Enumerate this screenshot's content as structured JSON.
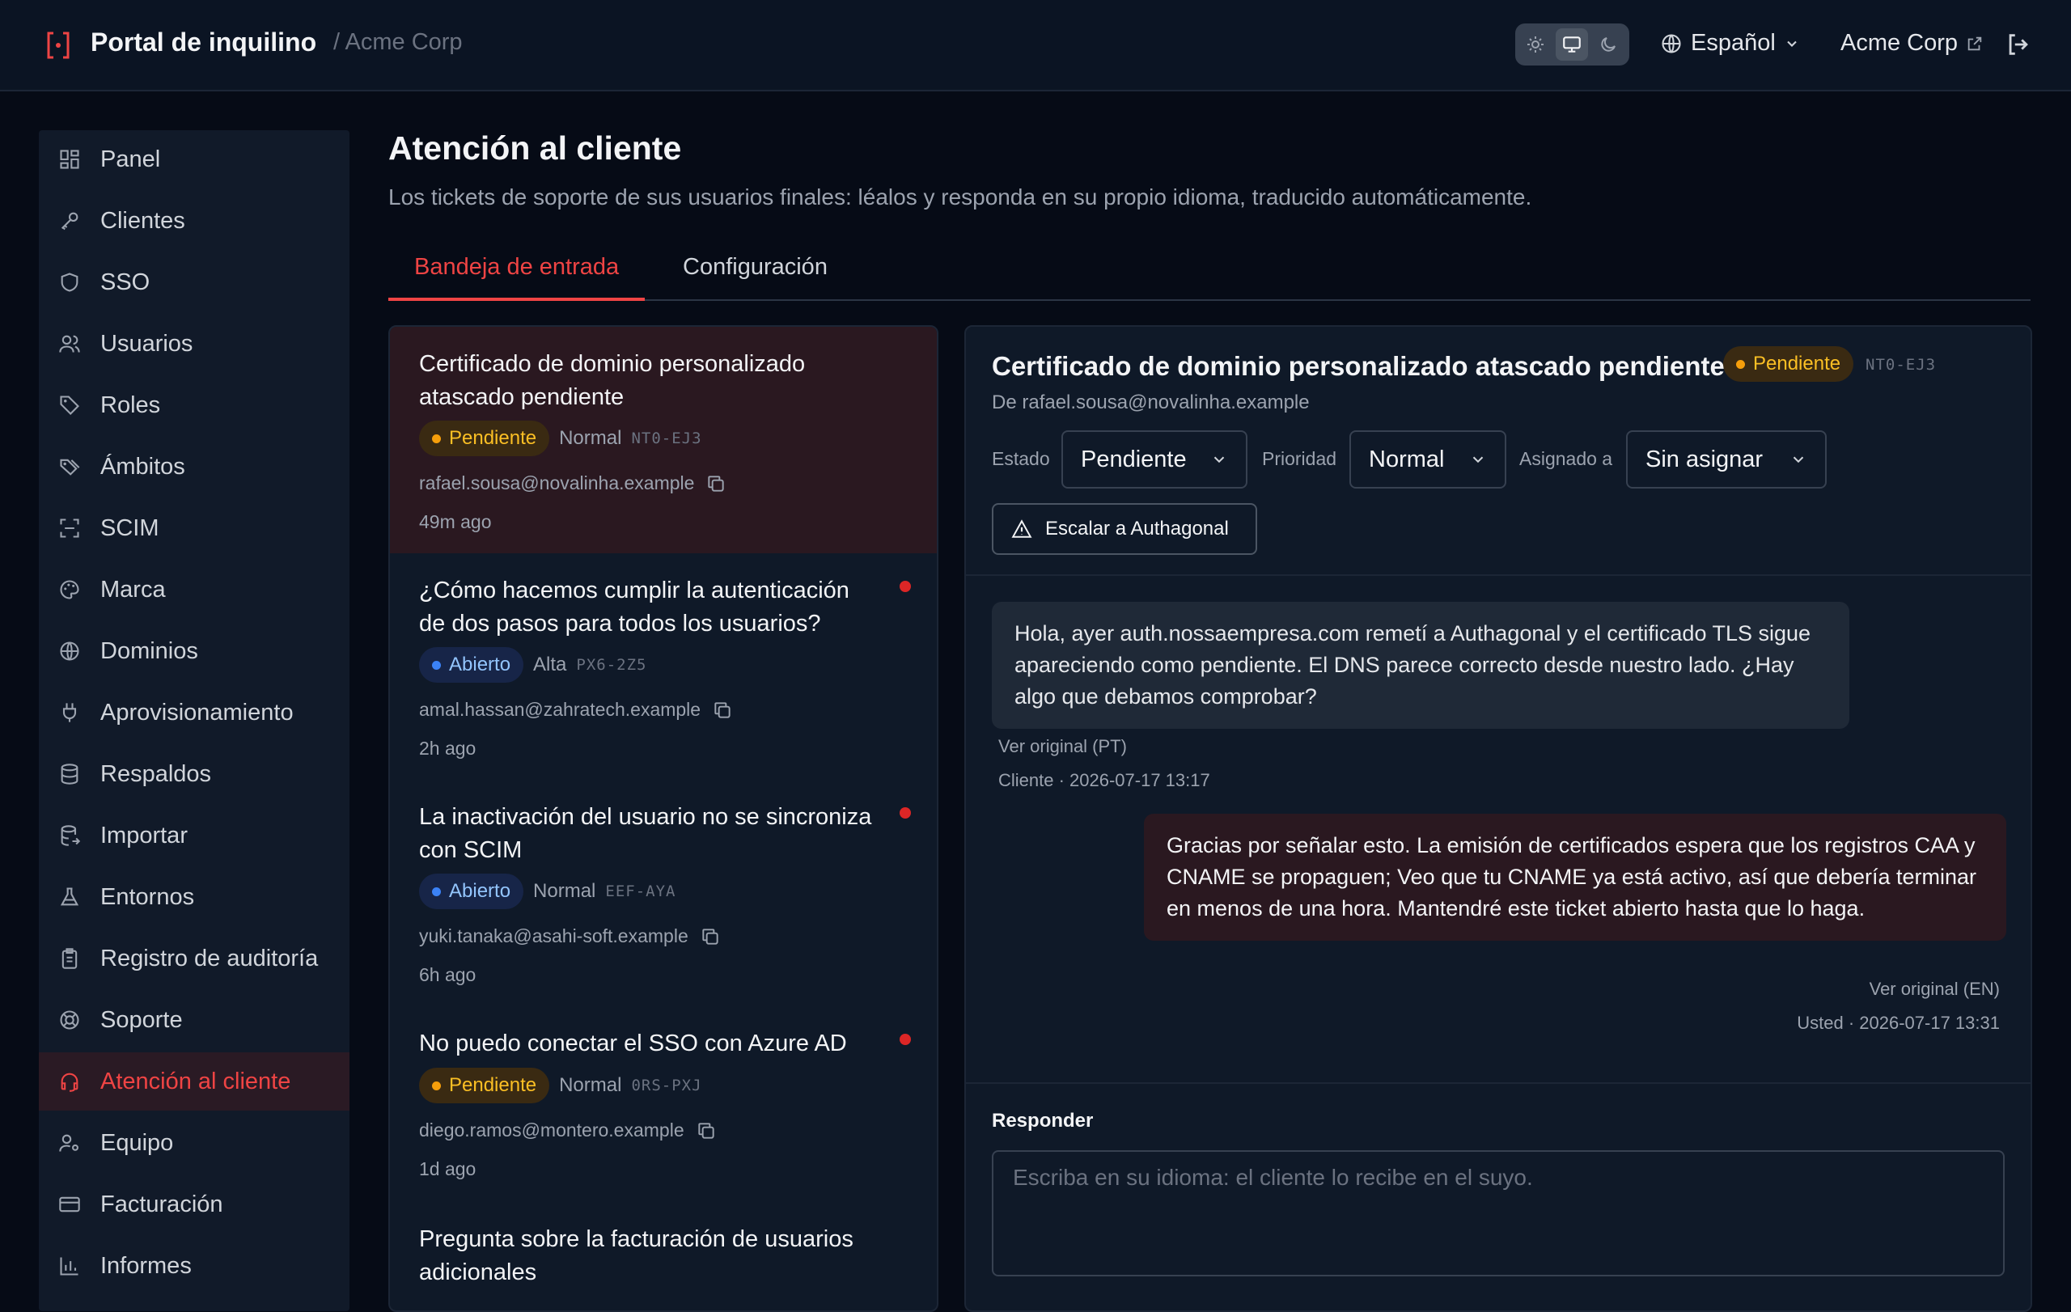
{
  "header": {
    "app_title": "Portal de inquilino",
    "tenant_breadcrumb": "/ Acme Corp",
    "theme_options": [
      "light",
      "system",
      "dark"
    ],
    "theme_selected": "system",
    "language": "Español",
    "tenant_link": "Acme Corp"
  },
  "sidebar": {
    "items": [
      {
        "label": "Panel",
        "icon": "dashboard-icon"
      },
      {
        "label": "Clientes",
        "icon": "key-icon"
      },
      {
        "label": "SSO",
        "icon": "shield-icon"
      },
      {
        "label": "Usuarios",
        "icon": "users-icon"
      },
      {
        "label": "Roles",
        "icon": "tag-icon"
      },
      {
        "label": "Ámbitos",
        "icon": "tags-icon"
      },
      {
        "label": "SCIM",
        "icon": "scan-icon"
      },
      {
        "label": "Marca",
        "icon": "palette-icon"
      },
      {
        "label": "Dominios",
        "icon": "globe-icon"
      },
      {
        "label": "Aprovisionamiento",
        "icon": "plug-icon"
      },
      {
        "label": "Respaldos",
        "icon": "database-icon"
      },
      {
        "label": "Importar",
        "icon": "database-import-icon"
      },
      {
        "label": "Entornos",
        "icon": "flask-icon"
      },
      {
        "label": "Registro de auditoría",
        "icon": "clipboard-icon"
      },
      {
        "label": "Soporte",
        "icon": "lifebuoy-icon"
      },
      {
        "label": "Atención al cliente",
        "icon": "headset-icon",
        "active": true
      },
      {
        "label": "Equipo",
        "icon": "user-cog-icon"
      },
      {
        "label": "Facturación",
        "icon": "credit-card-icon"
      },
      {
        "label": "Informes",
        "icon": "bar-chart-icon"
      }
    ]
  },
  "page": {
    "title": "Atención al cliente",
    "subtitle": "Los tickets de soporte de sus usuarios finales: léalos y responda en su propio idioma, traducido automáticamente.",
    "tabs": [
      {
        "label": "Bandeja de entrada",
        "active": true
      },
      {
        "label": "Configuración",
        "active": false
      }
    ]
  },
  "tickets": [
    {
      "title": "Certificado de dominio personalizado atascado pendiente",
      "status": "Pendiente",
      "status_kind": "pending",
      "priority": "Normal",
      "code": "NT0-EJ3",
      "email": "rafael.sousa@novalinha.example",
      "time": "49m ago",
      "selected": true,
      "unread": false
    },
    {
      "title": "¿Cómo hacemos cumplir la autenticación de dos pasos para todos los usuarios?",
      "status": "Abierto",
      "status_kind": "open",
      "priority": "Alta",
      "code": "PX6-2Z5",
      "email": "amal.hassan@zahratech.example",
      "time": "2h ago",
      "selected": false,
      "unread": true
    },
    {
      "title": "La inactivación del usuario no se sincroniza con SCIM",
      "status": "Abierto",
      "status_kind": "open",
      "priority": "Normal",
      "code": "EEF-AYA",
      "email": "yuki.tanaka@asahi-soft.example",
      "time": "6h ago",
      "selected": false,
      "unread": true
    },
    {
      "title": "No puedo conectar el SSO con Azure AD",
      "status": "Pendiente",
      "status_kind": "pending",
      "priority": "Normal",
      "code": "0RS-PXJ",
      "email": "diego.ramos@montero.example",
      "time": "1d ago",
      "selected": false,
      "unread": true
    },
    {
      "title": "Pregunta sobre la facturación de usuarios adicionales",
      "status": "",
      "status_kind": "",
      "priority": "",
      "code": "",
      "email": "",
      "time": "",
      "selected": false,
      "unread": false
    }
  ],
  "detail": {
    "title": "Certificado de dominio personalizado atascado pendiente",
    "status_badge": "Pendiente",
    "code": "NT0-EJ3",
    "from": "De rafael.sousa@novalinha.example",
    "fields": {
      "status_label": "Estado",
      "status_value": "Pendiente",
      "priority_label": "Prioridad",
      "priority_value": "Normal",
      "assignee_label": "Asignado a",
      "assignee_value": "Sin asignar"
    },
    "escalate_label": "Escalar a Authagonal",
    "messages": [
      {
        "text": "Hola, ayer auth.nossaempresa.com remetí a Authagonal y el certificado TLS sigue apareciendo como pendiente. El DNS parece correcto desde nuestro lado. ¿Hay algo que debamos comprobar?",
        "original_link": "Ver original (PT)",
        "meta": "Cliente · 2026-07-17 13:17"
      },
      {
        "text": "Gracias por señalar esto. La emisión de certificados espera que los registros CAA y CNAME se propaguen; Veo que tu CNAME ya está activo, así que debería terminar en menos de una hora. Mantendré este ticket abierto hasta que lo haga.",
        "original_link": "Ver original (EN)",
        "meta": "Usted · 2026-07-17 13:31"
      }
    ],
    "reply_label": "Responder",
    "reply_placeholder": "Escriba en su idioma: el cliente lo recibe en el suyo."
  },
  "colors": {
    "accent": "#ef4444",
    "pending": "#f59e0b",
    "open": "#3b82f6",
    "background": "#060b16"
  }
}
